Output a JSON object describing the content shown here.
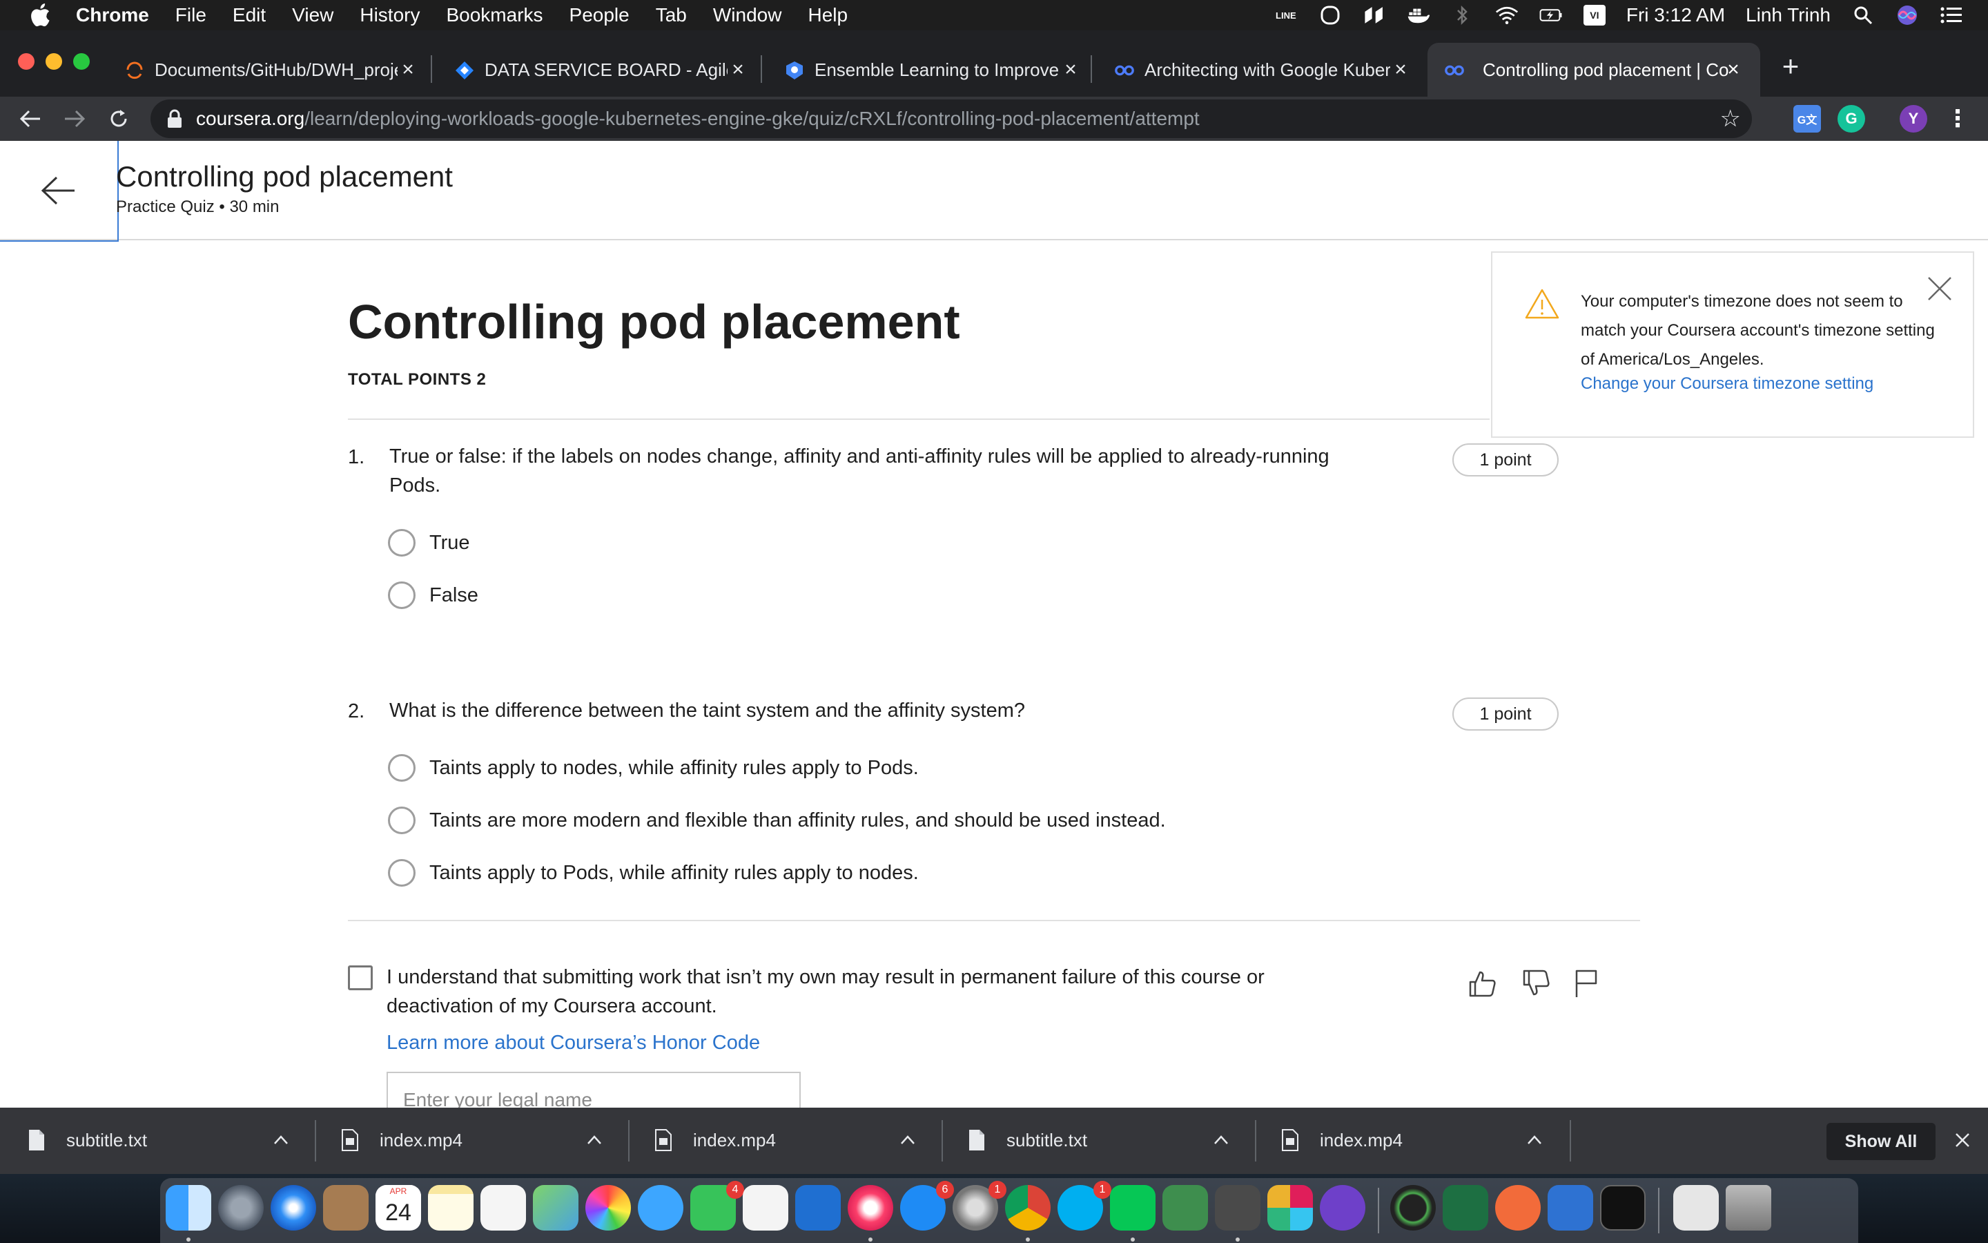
{
  "menubar": {
    "app": "Chrome",
    "items": [
      "File",
      "Edit",
      "View",
      "History",
      "Bookmarks",
      "People",
      "Tab",
      "Window",
      "Help"
    ],
    "clock": "Fri 3:12 AM",
    "user": "Linh Trinh",
    "line_label": "LINE",
    "input_source": "VI"
  },
  "tabs": [
    {
      "title": "Documents/GitHub/DWH_proje",
      "icon": "loading-spinner-icon"
    },
    {
      "title": "DATA SERVICE BOARD - Agile",
      "icon": "jira-icon"
    },
    {
      "title": "Ensemble Learning to Improve",
      "icon": "scholar-icon"
    },
    {
      "title": "Architecting with Google Kuber",
      "icon": "coursera-icon"
    },
    {
      "title": "Controlling pod placement | Co",
      "icon": "coursera-icon",
      "active": true
    }
  ],
  "omnibox": {
    "host": "coursera.org",
    "path": "/learn/deploying-workloads-google-kubernetes-engine-gke/quiz/cRXLf/controlling-pod-placement/attempt"
  },
  "extensions": {
    "profile_initial": "Y",
    "grammarly": "G"
  },
  "header": {
    "title": "Controlling pod placement",
    "subtitle": "Practice Quiz • 30 min"
  },
  "quiz": {
    "title": "Controlling pod placement",
    "total_points": "TOTAL POINTS 2",
    "questions": [
      {
        "number": "1.",
        "text": "True or false: if the labels on nodes change, affinity and anti-affinity rules will be applied to already-running Pods.",
        "points": "1 point",
        "options": [
          "True",
          "False"
        ]
      },
      {
        "number": "2.",
        "text": "What is the difference between the taint system and the affinity system?",
        "points": "1 point",
        "options": [
          "Taints apply to nodes, while affinity rules apply to Pods.",
          "Taints are more modern and flexible than affinity rules, and should be used instead.",
          "Taints apply to Pods, while affinity rules apply to nodes."
        ]
      }
    ],
    "honor": {
      "text": "I understand that submitting work that isn’t my own may result in permanent failure of this course or deactivation of my Coursera account.",
      "link": "Learn more about Coursera’s Honor Code",
      "legal_name_placeholder": "Enter your legal name"
    }
  },
  "timezone_notice": {
    "text": "Your computer's timezone does not seem to match your Coursera account's timezone setting of America/Los_Angeles.",
    "link": "Change your Coursera timezone setting"
  },
  "downloads": {
    "files": [
      "subtitle.txt",
      "index.mp4",
      "index.mp4",
      "subtitle.txt",
      "index.mp4"
    ],
    "show_all": "Show All"
  },
  "dock": {
    "calendar_month": "APR",
    "calendar_day": "24",
    "badges": {
      "facetime": "4",
      "appstore": "6",
      "preferences": "1",
      "skype": "1"
    }
  },
  "colors": {
    "link": "#2a73cc",
    "chrome_dark": "#202124",
    "focus_outline": "#3a7bd5"
  }
}
